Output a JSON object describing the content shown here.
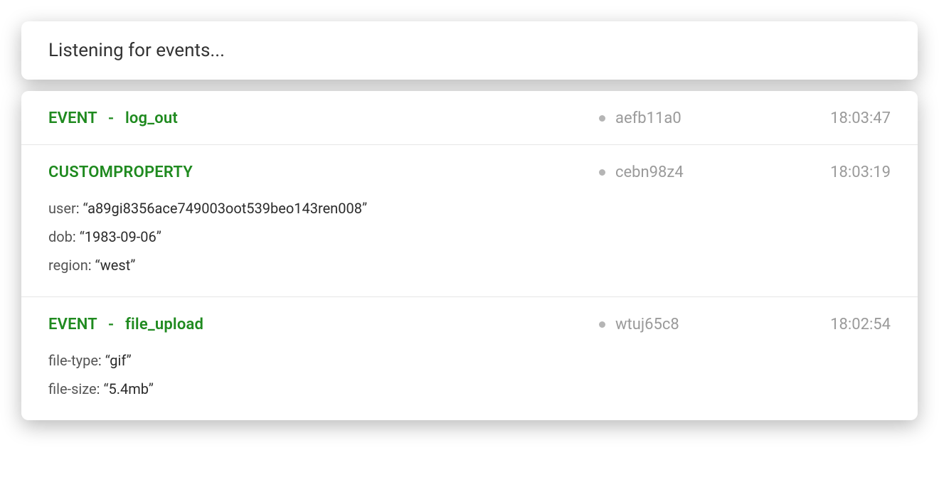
{
  "header": {
    "title": "Listening for events..."
  },
  "events": [
    {
      "prefix": "EVENT",
      "name": "log_out",
      "dash": "-",
      "id": "aefb11a0",
      "time": "18:03:47",
      "props": []
    },
    {
      "prefix": "CUSTOMPROPERTY",
      "name": "",
      "dash": "",
      "id": "cebn98z4",
      "time": "18:03:19",
      "props": [
        {
          "key": "user",
          "value": "a89gi8356ace749003oot539beo143ren008"
        },
        {
          "key": "dob",
          "value": "1983-09-06"
        },
        {
          "key": "region",
          "value": "west"
        }
      ]
    },
    {
      "prefix": "EVENT",
      "name": "file_upload",
      "dash": "-",
      "id": "wtuj65c8",
      "time": "18:02:54",
      "props": [
        {
          "key": "file-type",
          "value": "gif"
        },
        {
          "key": "file-size",
          "value": "5.4mb"
        }
      ]
    }
  ]
}
